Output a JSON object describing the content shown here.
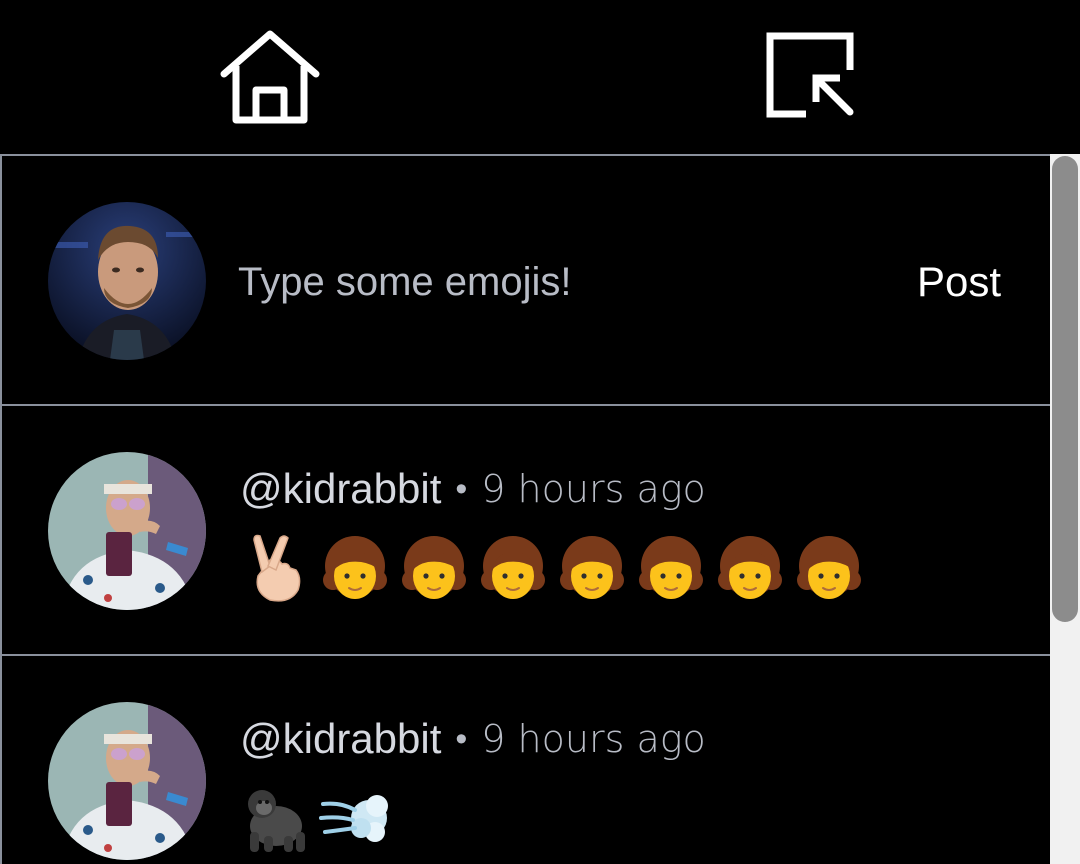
{
  "nav": {
    "home_icon": "home-icon",
    "logout_icon": "logout-icon",
    "icon_color": "#ffffff"
  },
  "composer": {
    "placeholder": "Type some emojis!",
    "value": "",
    "post_label": "Post"
  },
  "posts": [
    {
      "username": "@kidrabbit",
      "separator": "•",
      "timestamp": "9 hours ago",
      "emojis": [
        "crossed-fingers",
        "woman",
        "woman",
        "woman",
        "woman",
        "woman",
        "woman",
        "woman"
      ]
    },
    {
      "username": "@kidrabbit",
      "separator": "•",
      "timestamp": "9 hours ago",
      "emojis": [
        "gorilla",
        "dash"
      ]
    }
  ],
  "colors": {
    "background": "#000000",
    "divider": "#8a909c",
    "muted_text": "#b8bcc6",
    "scroll_thumb": "#8c8c8c",
    "scroll_track": "#f1f1f1"
  },
  "scrollbar": {
    "position_fraction": 0.0,
    "visible_fraction": 0.66
  }
}
